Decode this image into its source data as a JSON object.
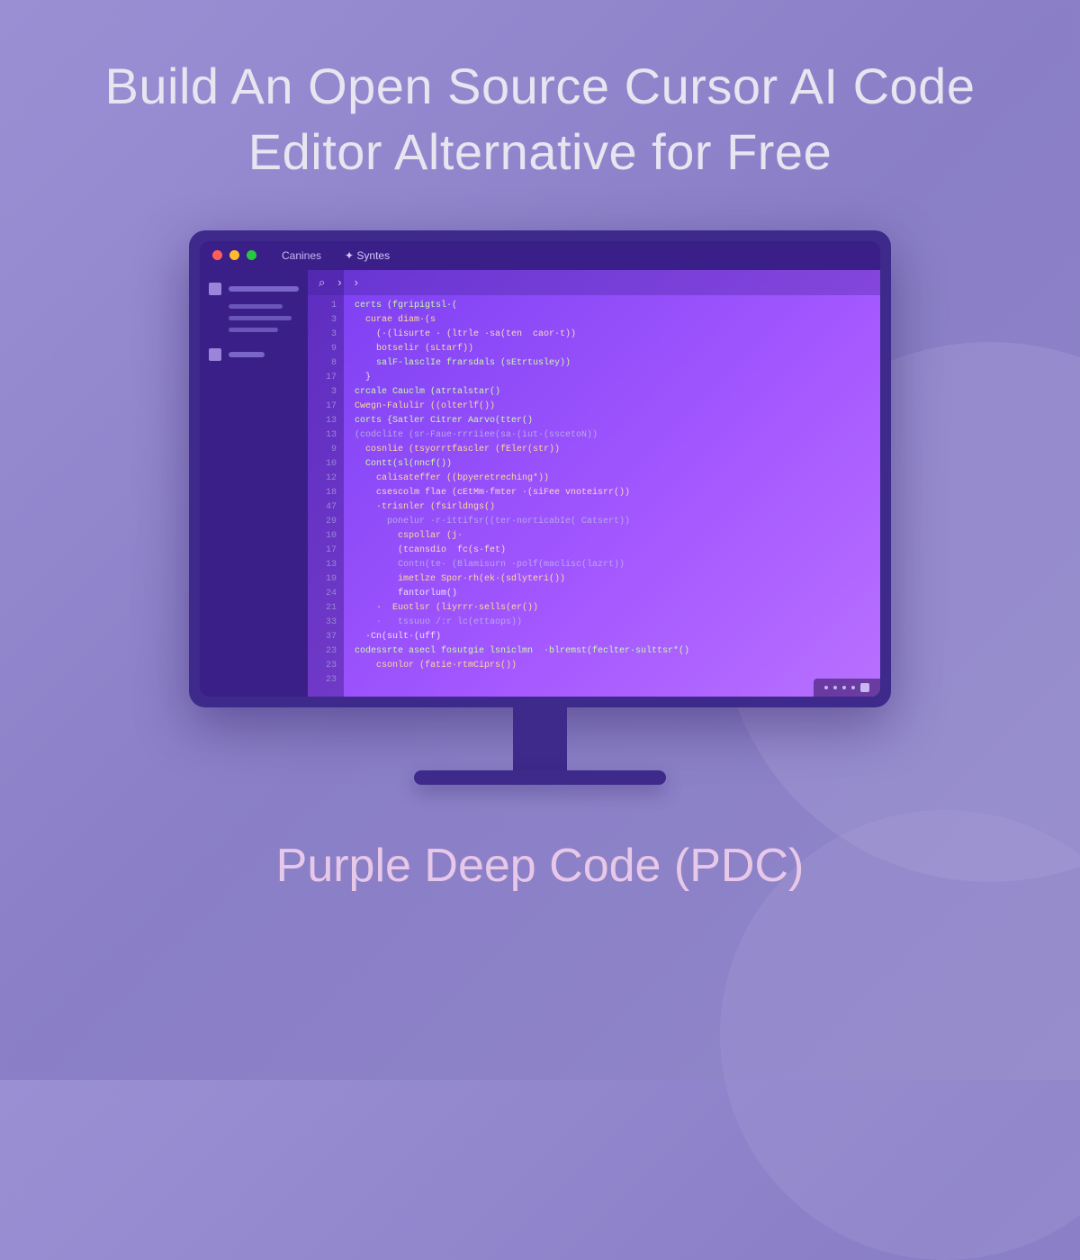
{
  "headline": "Build An Open Source Cursor AI Code Editor Alternative for Free",
  "footer": "Purple Deep Code (PDC)",
  "titlebar": {
    "menu1": "Canines",
    "tab1": "✦ Syntes"
  },
  "editor_toolbar": {
    "search": "⌕",
    "back": "›",
    "forward": "›"
  },
  "line_numbers": [
    "1",
    "3",
    "3",
    "9",
    "8",
    "17",
    "3",
    "17",
    "13",
    "13",
    "9",
    "10",
    "12",
    "18",
    "47",
    "29",
    "10",
    "17",
    "13",
    "19",
    "24",
    "21",
    "33",
    "37",
    "23",
    "23",
    "23"
  ],
  "code_lines": [
    {
      "t": "certs (fgripigtsl·(",
      "c": "kw"
    },
    {
      "t": "  curae diam·(s",
      "c": "fn"
    },
    {
      "t": "    (·(lisurte · (ltrle ·sa(ten  caor·t))",
      "c": "str"
    },
    {
      "t": "    botselir (sLtarf))",
      "c": "fn"
    },
    {
      "t": "    salF-lasclIe frarsdals (sEtrtusley))",
      "c": "kw"
    },
    {
      "t": "  }",
      "c": "pn"
    },
    {
      "t": "",
      "c": "pn"
    },
    {
      "t": "crcale Cauclm (atrtalstar()",
      "c": "kw"
    },
    {
      "t": "Cwegn-Falulir ((olterlf())",
      "c": "fn"
    },
    {
      "t": "",
      "c": "pn"
    },
    {
      "t": "corts {Satler Citrer Aarvo(tter()",
      "c": "kw"
    },
    {
      "t": "(codclite (sr-Faue·rrriiee(sa·(iut·(sscetoN))",
      "c": "cm"
    },
    {
      "t": "  cosnlie (tsyorrtfascler (fEler(str))",
      "c": "fn"
    },
    {
      "t": "",
      "c": "pn"
    },
    {
      "t": "  Contt(sl(nncf())",
      "c": "kw"
    },
    {
      "t": "    calisateffer ((bpyeretreching*))",
      "c": "fn"
    },
    {
      "t": "    csescolm flae (cEtMm·fmter ·(siFee vnoteisrr())",
      "c": "str"
    },
    {
      "t": "    ·trisnler (fsirldngs()",
      "c": "fn"
    },
    {
      "t": "      ponelur ·r·ittifsr((ter·norticabIe( Catsert))",
      "c": "cm"
    },
    {
      "t": "        cspollar (j·",
      "c": "fn"
    },
    {
      "t": "        (tcansdio  fc(s·fet)",
      "c": "str"
    },
    {
      "t": "        Contn(te· (Blamisurn ·polf(maclisc(lazrt))",
      "c": "cm"
    },
    {
      "t": "        imetlze Spor·rh(ek·(sdlyteri())",
      "c": "fn"
    },
    {
      "t": "        fantorlum()",
      "c": "pn"
    },
    {
      "t": "    ·  Euotlsr (liyrrr·sells(er())",
      "c": "fn"
    },
    {
      "t": "    ·   tssuuo /:r lc(ettaops))",
      "c": "cm"
    },
    {
      "t": "  ·Cn(sult·(uff)",
      "c": "pn"
    },
    {
      "t": "codessrte asecl fosutgie lsniclmn  ·blremst(feclter·sulttsr*()",
      "c": "kw"
    },
    {
      "t": "    csonlor (fatie·rtmCiprs())",
      "c": "fn"
    }
  ]
}
